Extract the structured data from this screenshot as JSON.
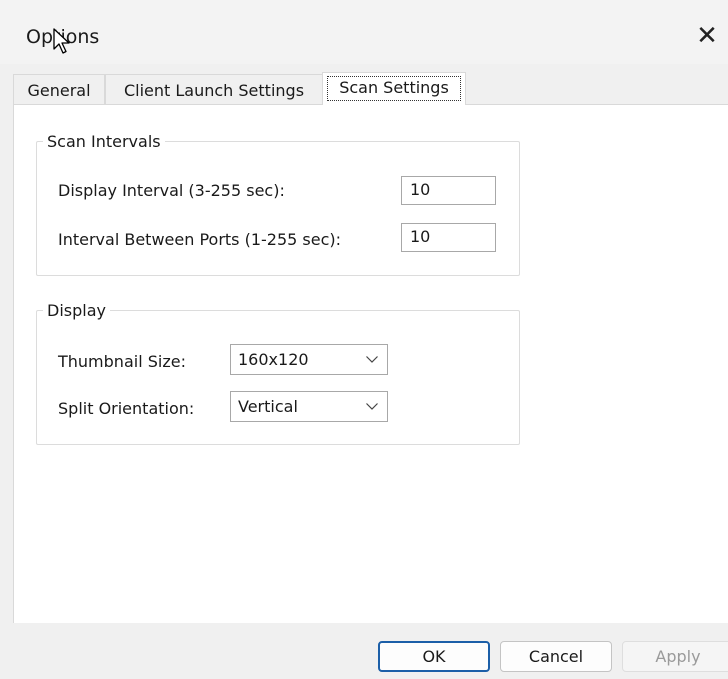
{
  "window": {
    "title": "Options",
    "close_glyph": "✕"
  },
  "tabs": [
    {
      "label": "General"
    },
    {
      "label": "Client Launch Settings"
    },
    {
      "label": "Scan Settings",
      "active": true
    }
  ],
  "scan_intervals": {
    "legend": "Scan Intervals",
    "display_interval_label": "Display Interval (3-255 sec):",
    "display_interval_value": "10",
    "ports_interval_label": "Interval Between Ports (1-255 sec):",
    "ports_interval_value": "10"
  },
  "display": {
    "legend": "Display",
    "thumbnail_label": "Thumbnail Size:",
    "thumbnail_value": "160x120",
    "split_label": "Split Orientation:",
    "split_value": "Vertical"
  },
  "buttons": {
    "ok": "OK",
    "cancel": "Cancel",
    "apply": "Apply"
  },
  "colors": {
    "default_button_border": "#1c5fa8",
    "disabled_text": "#9a9a9a"
  }
}
